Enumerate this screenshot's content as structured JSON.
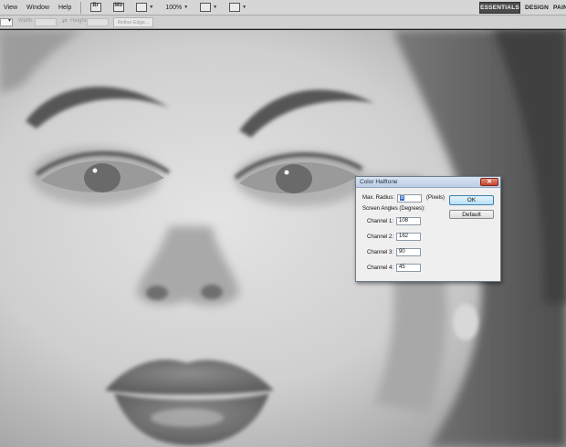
{
  "menu": {
    "items": [
      "View",
      "Window",
      "Help"
    ],
    "zoom": "100%"
  },
  "workspaces": {
    "essentials": "ESSENTIALS",
    "design": "DESIGN",
    "painting": "PAINTING"
  },
  "options_bar": {
    "width_label": "Width:",
    "height_label": "Height:",
    "refine_edge": "Refine Edge..."
  },
  "dialog": {
    "title": "Color Halftone",
    "max_radius_label": "Max. Radius:",
    "max_radius_value": "8",
    "max_radius_unit": "(Pixels)",
    "screen_angles_label": "Screen Angles (Degrees):",
    "channels": [
      {
        "label": "Channel 1:",
        "value": "108"
      },
      {
        "label": "Channel 2:",
        "value": "162"
      },
      {
        "label": "Channel 3:",
        "value": "90"
      },
      {
        "label": "Channel 4:",
        "value": "45"
      }
    ],
    "ok_label": "OK",
    "default_label": "Default",
    "close_glyph": "✕"
  },
  "colors": {
    "workspace_active": "#4a4a4a",
    "ok_button": "#b6dff6",
    "close_button": "#c4432b"
  }
}
